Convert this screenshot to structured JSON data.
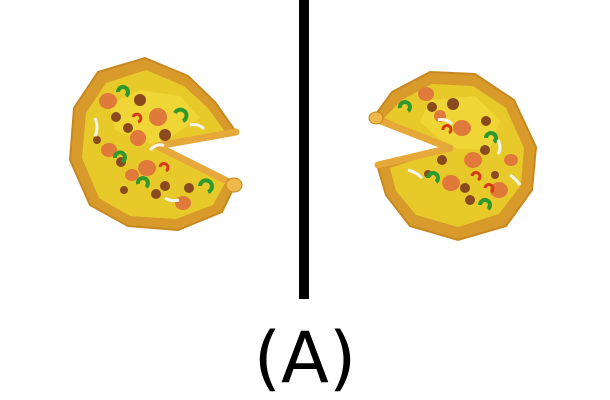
{
  "caption": "(A)",
  "colors": {
    "background": "#ffffff",
    "divider": "#000000",
    "crust_dark": "#d89a2b",
    "crust_light": "#f0b84a",
    "cheese": "#e8c92a",
    "cheese_light": "#f2da3c",
    "pepperoni": "#e07a3a",
    "sausage": "#8a4a1e",
    "pepper_green": "#2e9a2e",
    "pepper_red": "#d63a1a",
    "onion": "#f4f4ee"
  },
  "pizzas": [
    {
      "name": "left-pizza",
      "icon": "pizza-missing-slice-icon"
    },
    {
      "name": "right-pizza",
      "icon": "pizza-missing-slice-icon"
    }
  ]
}
